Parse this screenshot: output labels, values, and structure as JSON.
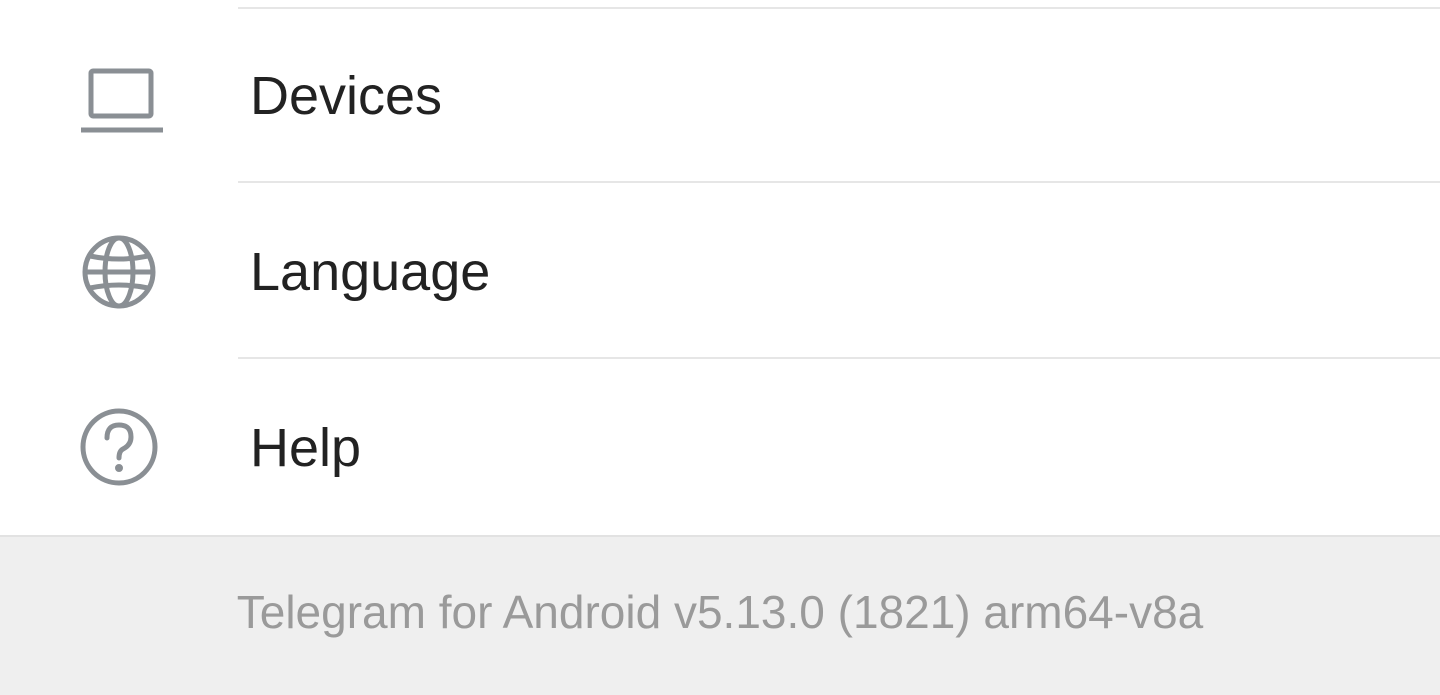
{
  "menu": {
    "items": [
      {
        "icon": "laptop-icon",
        "label": "Devices"
      },
      {
        "icon": "globe-icon",
        "label": "Language"
      },
      {
        "icon": "help-circle-icon",
        "label": "Help"
      }
    ]
  },
  "footer": {
    "version_text": "Telegram for Android v5.13.0 (1821) arm64-v8a"
  },
  "colors": {
    "icon": "#8a8f94",
    "label": "#222222",
    "divider": "#e6e6e6",
    "footer_bg": "#efefef",
    "footer_text": "#9a9a9a"
  }
}
